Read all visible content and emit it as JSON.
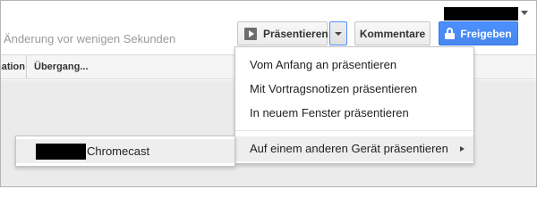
{
  "header": {
    "status_text": "Änderung vor wenigen Sekunden",
    "buttons": {
      "present_label": "Präsentieren",
      "comments_label": "Kommentare",
      "share_label": "Freigeben"
    }
  },
  "toolbar": {
    "animation_label": "Animation...",
    "transition_label": "Übergang..."
  },
  "present_menu": {
    "items": [
      {
        "label": "Vom Anfang an präsentieren"
      },
      {
        "label": "Mit Vortragsnotizen präsentieren"
      },
      {
        "label": "In neuem Fenster präsentieren"
      },
      {
        "label": "Auf einem anderen Gerät präsentieren"
      }
    ]
  },
  "device_submenu": {
    "items": [
      {
        "label": "Chromecast"
      }
    ]
  },
  "colors": {
    "share_button_bg": "#4d90fe",
    "focus_border": "#4d90fe",
    "hover_bg": "#eeeeee",
    "canvas_bg": "#ebebeb"
  },
  "icons": {
    "present": "play-icon",
    "share": "lock-icon",
    "dropdown": "chevron-down-icon",
    "submenu": "chevron-right-icon"
  }
}
